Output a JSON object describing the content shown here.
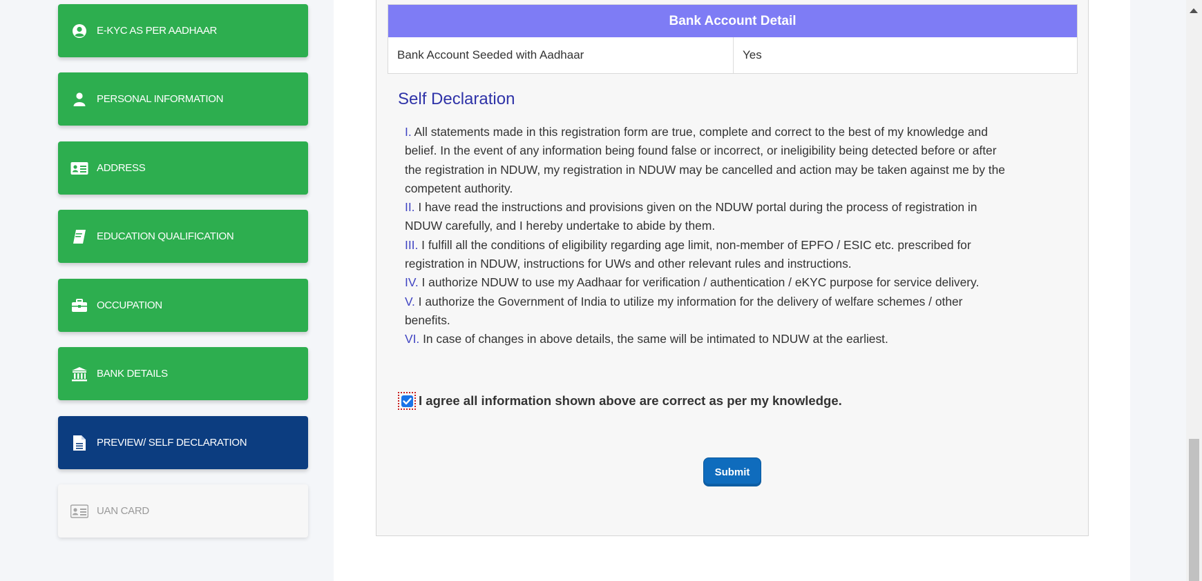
{
  "sidebar": {
    "items": [
      {
        "label": "E-KYC AS PER AADHAAR",
        "icon": "user-circle-icon"
      },
      {
        "label": "PERSONAL INFORMATION",
        "icon": "user-icon"
      },
      {
        "label": "ADDRESS",
        "icon": "address-card-icon"
      },
      {
        "label": "EDUCATION QUALIFICATION",
        "icon": "book-icon"
      },
      {
        "label": "OCCUPATION",
        "icon": "briefcase-icon"
      },
      {
        "label": "BANK DETAILS",
        "icon": "bank-icon"
      },
      {
        "label": "PREVIEW/ SELF DECLARATION",
        "icon": "file-icon"
      },
      {
        "label": "UAN CARD",
        "icon": "id-card-icon"
      }
    ],
    "colors": {
      "completed": "#2dae4f",
      "active": "#0c3d80",
      "disabled": "#f7f7f7"
    }
  },
  "bank": {
    "title": "Bank Account Detail",
    "rows": [
      {
        "label": "Bank Account Seeded with Aadhaar",
        "value": "Yes"
      }
    ]
  },
  "declaration": {
    "title": "Self Declaration",
    "lines": [
      {
        "num": "I.",
        "text": " All statements made in this registration form are true, complete and correct to the best of my knowledge and"
      },
      {
        "num": "",
        "text": "belief. In the event of any information being found false or incorrect, or ineligibility being detected before or after"
      },
      {
        "num": "",
        "text": "the registration in NDUW, my registration in NDUW may be cancelled and action may be taken against me by the"
      },
      {
        "num": "",
        "text": "competent authority."
      },
      {
        "num": "II.",
        "text": " I have read the instructions and provisions given on the NDUW portal during the process of registration in"
      },
      {
        "num": "",
        "text": "NDUW carefully, and I hereby undertake to abide by them."
      },
      {
        "num": "III.",
        "text": " I fulfill all the conditions of eligibility regarding age limit, non-member of EPFO / ESIC etc. prescribed for"
      },
      {
        "num": "",
        "text": "registration in NDUW, instructions for UWs and other relevant rules and instructions."
      },
      {
        "num": "IV.",
        "text": " I authorize NDUW to use my Aadhaar for verification / authentication / eKYC purpose for service delivery."
      },
      {
        "num": "V.",
        "text": " I authorize the Government of India to utilize my information for the delivery of welfare schemes / other"
      },
      {
        "num": "",
        "text": "benefits."
      },
      {
        "num": "VI.",
        "text": " In case of changes in above details, the same will be intimated to NDUW at the earliest."
      }
    ],
    "agree_text": "I agree all information shown above are correct as per my knowledge.",
    "agree_checked": true
  },
  "submit_label": "Submit"
}
